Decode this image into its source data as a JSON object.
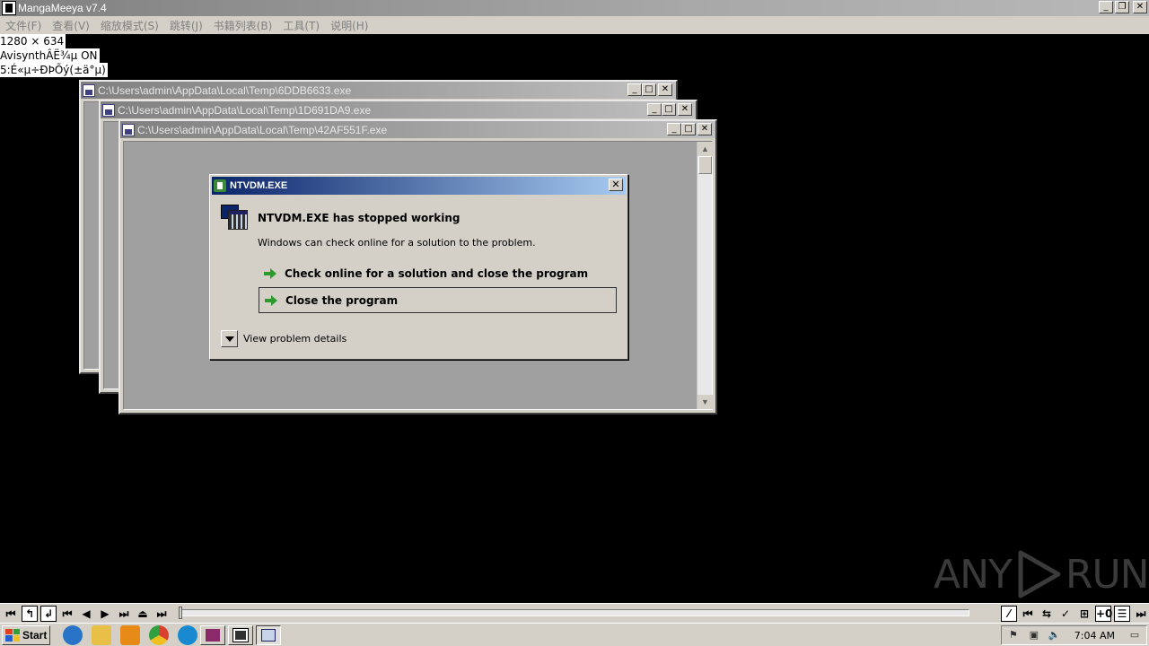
{
  "app": {
    "title": "MangaMeeya v7.4",
    "menu": [
      {
        "label": "文件(F)"
      },
      {
        "label": "查看(V)"
      },
      {
        "label": "缩放模式(S)"
      },
      {
        "label": "跳转(J)"
      },
      {
        "label": "书籍列表(B)"
      },
      {
        "label": "工具(T)"
      },
      {
        "label": "说明(H)"
      }
    ],
    "window_buttons": {
      "minimize": "_",
      "restore": "❐",
      "close": "✕"
    }
  },
  "info_overlay": {
    "resolution": "1280 × 634",
    "avisynth": "AvisynthÂË¾µ ON",
    "line3": "5:É«µ÷ÐÞÕý(±ä°µ)"
  },
  "console_windows": [
    {
      "title": "C:\\Users\\admin\\AppData\\Local\\Temp\\6DDB6633.exe"
    },
    {
      "title": "C:\\Users\\admin\\AppData\\Local\\Temp\\1D691DA9.exe"
    },
    {
      "title": "C:\\Users\\admin\\AppData\\Local\\Temp\\42AF551F.exe"
    }
  ],
  "console_buttons": {
    "minimize": "_",
    "maximize": "□",
    "close": "✕"
  },
  "dialog": {
    "title": "NTVDM.EXE",
    "close": "✕",
    "heading": "NTVDM.EXE has stopped working",
    "subtext": "Windows can check online for a solution to the problem.",
    "options": [
      {
        "label": "Check online for a solution and close the program",
        "selected": false
      },
      {
        "label": "Close the program",
        "selected": true
      }
    ],
    "details_label": "View problem details"
  },
  "watermark": {
    "left": "ANY",
    "right": "RUN"
  },
  "player": {
    "left_buttons": [
      "⏮",
      "↰",
      "↲",
      "⏮",
      "◀",
      "▶",
      "⏭",
      "⏏",
      "⏭"
    ],
    "right_buttons": [
      "⁄",
      "⏮",
      "⇆",
      "✓",
      "⊞",
      "+0",
      "☰",
      "⏭"
    ]
  },
  "taskbar": {
    "start_label": "Start",
    "clock": "7:04 AM",
    "colors": {
      "ie": "#2a74c8",
      "explorer": "#e8c048",
      "media": "#e88a18",
      "chrome": "#d84030",
      "edge": "#1a8ad0",
      "winrar": "#8a2a6a"
    }
  }
}
